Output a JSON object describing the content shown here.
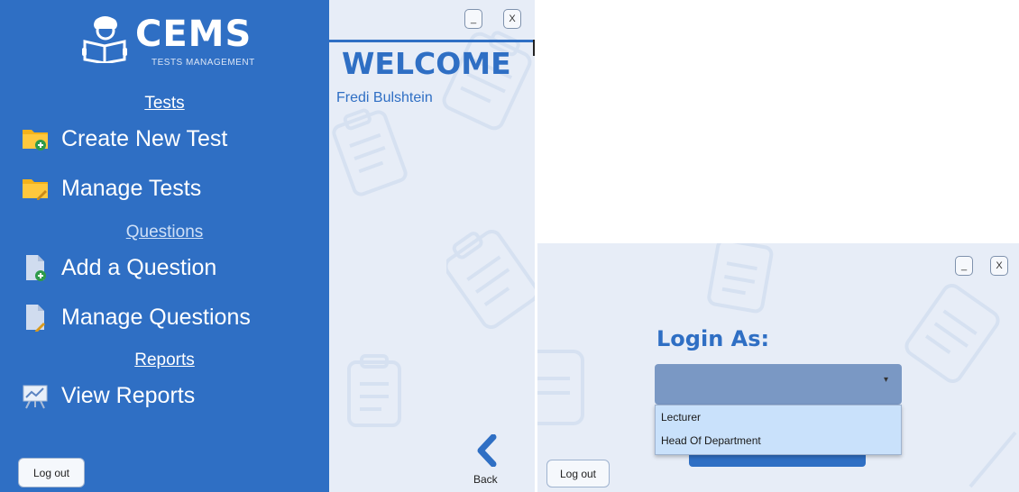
{
  "app": {
    "name": "CEMS",
    "subtitle": "TESTS MANAGEMENT"
  },
  "sidebar": {
    "sections": [
      {
        "label": "Tests"
      },
      {
        "label": "Questions"
      },
      {
        "label": "Reports"
      }
    ],
    "items": [
      {
        "label": "Create New Test",
        "icon": "folder-add-icon"
      },
      {
        "label": "Manage Tests",
        "icon": "folder-edit-icon"
      },
      {
        "label": "Add a Question",
        "icon": "document-add-icon"
      },
      {
        "label": "Manage Questions",
        "icon": "document-edit-icon"
      },
      {
        "label": "View Reports",
        "icon": "presentation-chart-icon"
      }
    ],
    "logout_label": "Log out"
  },
  "main": {
    "minimize_label": "_",
    "close_label": "X",
    "welcome": "WELCOME",
    "user_name": "Fredi Bulshtein",
    "back_label": "Back"
  },
  "login": {
    "minimize_label": "_",
    "close_label": "X",
    "title": "Login As:",
    "select_value": "",
    "options": [
      "Lecturer",
      "Head Of Department"
    ],
    "logout_label": "Log out"
  },
  "colors": {
    "primary": "#2f6fc4",
    "panel_bg": "#e7edf7",
    "select_bg": "#7a98c4",
    "dropdown_bg": "#c9e1fb"
  }
}
